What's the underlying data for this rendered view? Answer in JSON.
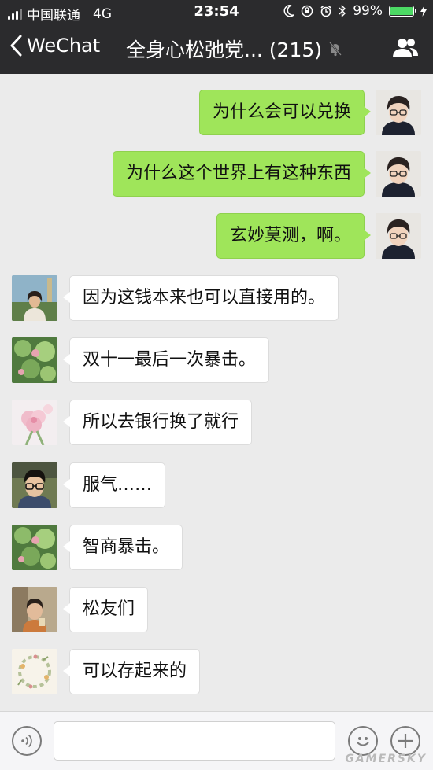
{
  "status_bar": {
    "carrier": "中国联通",
    "network": "4G",
    "time": "23:54",
    "battery_percent": "99%",
    "battery_level": 0.99
  },
  "nav": {
    "back_label": "WeChat",
    "title": "全身心松弛党... (215)"
  },
  "messages": [
    {
      "side": "me",
      "text": "为什么会可以兑换",
      "avatar": "me-avatar"
    },
    {
      "side": "me",
      "text": "为什么这个世界上有这种东西",
      "avatar": "me-avatar"
    },
    {
      "side": "me",
      "text": "玄妙莫测，啊。",
      "avatar": "me-avatar"
    },
    {
      "side": "them",
      "text": "因为这钱本来也可以直接用的。",
      "avatar": "girl-avatar"
    },
    {
      "side": "them",
      "text": "双十一最后一次暴击。",
      "avatar": "plant-avatar"
    },
    {
      "side": "them",
      "text": "所以去银行换了就行",
      "avatar": "flower-avatar"
    },
    {
      "side": "them",
      "text": "服气……",
      "avatar": "glasses-avatar"
    },
    {
      "side": "them",
      "text": "智商暴击。",
      "avatar": "plant-avatar"
    },
    {
      "side": "them",
      "text": "松友们",
      "avatar": "child-avatar"
    },
    {
      "side": "them",
      "text": "可以存起来的",
      "avatar": "wreath-avatar"
    }
  ],
  "input": {
    "placeholder": ""
  },
  "watermark": "GAMERSKY",
  "colors": {
    "bar_bg": "#2b2b2d",
    "chat_bg": "#ebebeb",
    "my_bubble": "#9fe55a",
    "their_bubble": "#ffffff",
    "battery": "#4cd964"
  }
}
